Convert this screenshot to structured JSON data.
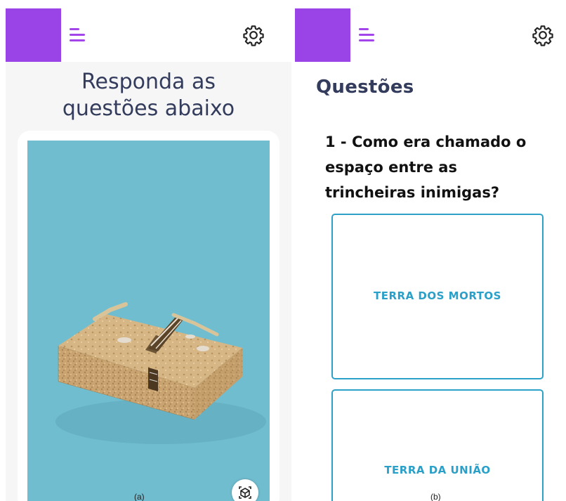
{
  "panel_a": {
    "title": "Responda as\nquestões abaixo",
    "caption": "(a)",
    "icons": [
      "menu-icon",
      "gear-icon",
      "ar-cube-icon"
    ]
  },
  "panel_b": {
    "title": "Questões",
    "question": "1 - Como era chamado o espaço entre as trincheiras inimigas?",
    "options": [
      {
        "label": "TERRA DOS MORTOS"
      },
      {
        "label": "TERRA DA UNIÃO"
      }
    ],
    "caption": "(b)",
    "icons": [
      "menu-icon",
      "gear-icon"
    ]
  },
  "colors": {
    "accent_purple": "#9a43e6",
    "title_navy": "#333c5c",
    "option_blue": "#2ea1c8",
    "scene_blue": "#70bdd0"
  }
}
